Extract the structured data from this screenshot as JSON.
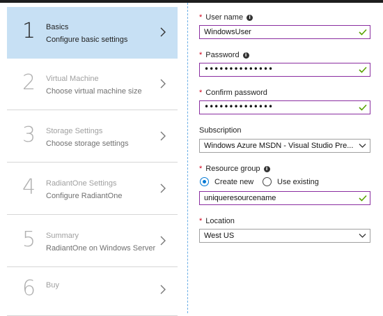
{
  "steps": [
    {
      "number": "1",
      "title": "Basics",
      "subtitle": "Configure basic settings",
      "active": true
    },
    {
      "number": "2",
      "title": "Virtual Machine",
      "subtitle": "Choose virtual machine size",
      "active": false
    },
    {
      "number": "3",
      "title": "Storage Settings",
      "subtitle": "Choose storage settings",
      "active": false
    },
    {
      "number": "4",
      "title": "RadiantOne Settings",
      "subtitle": "Configure RadiantOne",
      "active": false
    },
    {
      "number": "5",
      "title": "Summary",
      "subtitle": "RadiantOne on Windows Server",
      "active": false
    },
    {
      "number": "6",
      "title": "Buy",
      "subtitle": "",
      "active": false
    }
  ],
  "form": {
    "username": {
      "label": "User name",
      "value": "WindowsUser",
      "required": true
    },
    "password": {
      "label": "Password",
      "value": "••••••••••••••",
      "required": true
    },
    "confirm_password": {
      "label": "Confirm password",
      "value": "••••••••••••••",
      "required": true
    },
    "subscription": {
      "label": "Subscription",
      "value": "Windows Azure MSDN - Visual Studio Pre..."
    },
    "resource_group": {
      "label": "Resource group",
      "required": true,
      "option_new": "Create new",
      "option_existing": "Use existing",
      "selected": "Create new",
      "value": "uniqueresourcename"
    },
    "location": {
      "label": "Location",
      "value": "West US",
      "required": true
    }
  },
  "colors": {
    "active_step_bg": "#c7e0f4",
    "required_star": "#d0021b",
    "valid_check": "#57a300",
    "field_border_focus": "#8a2da0",
    "radio_selected": "#0078d4"
  }
}
